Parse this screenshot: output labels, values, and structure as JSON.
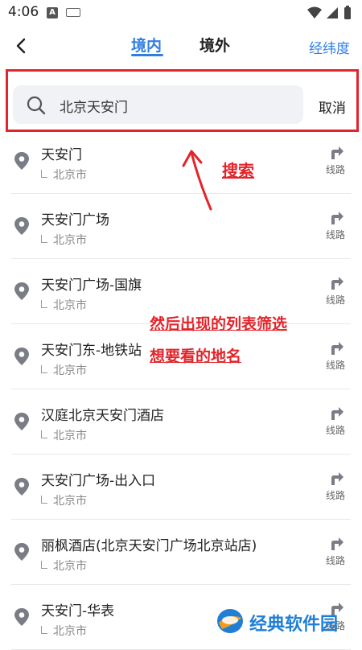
{
  "status_bar": {
    "time": "4:06",
    "notif_letter": "A"
  },
  "nav": {
    "tabs": [
      {
        "label": "境内",
        "active": true
      },
      {
        "label": "境外",
        "active": false
      }
    ],
    "latlng_label": "经纬度"
  },
  "search": {
    "query": "北京天安门",
    "cancel_label": "取消"
  },
  "results": [
    {
      "name": "天安门",
      "city": "北京市",
      "route_label": "线路"
    },
    {
      "name": "天安门广场",
      "city": "北京市",
      "route_label": "线路"
    },
    {
      "name": "天安门广场-国旗",
      "city": "北京市",
      "route_label": "线路"
    },
    {
      "name": "天安门东-地铁站",
      "city": "北京市",
      "route_label": "线路"
    },
    {
      "name": "汉庭北京天安门酒店",
      "city": "北京市",
      "route_label": "线路"
    },
    {
      "name": "天安门广场-出入口",
      "city": "北京市",
      "route_label": "线路"
    },
    {
      "name": "丽枫酒店(北京天安门广场北京站店)",
      "city": "北京市",
      "route_label": "线路"
    },
    {
      "name": "天安门-华表",
      "city": "北京市",
      "route_label": "线路"
    }
  ],
  "annotations": {
    "search": "搜索",
    "line1": "然后出现的列表筛选",
    "line2": "想要看的地名"
  },
  "watermark": {
    "text": "经典软件园"
  },
  "colors": {
    "accent": "#2f7fe3",
    "annotation": "#e3242b"
  }
}
